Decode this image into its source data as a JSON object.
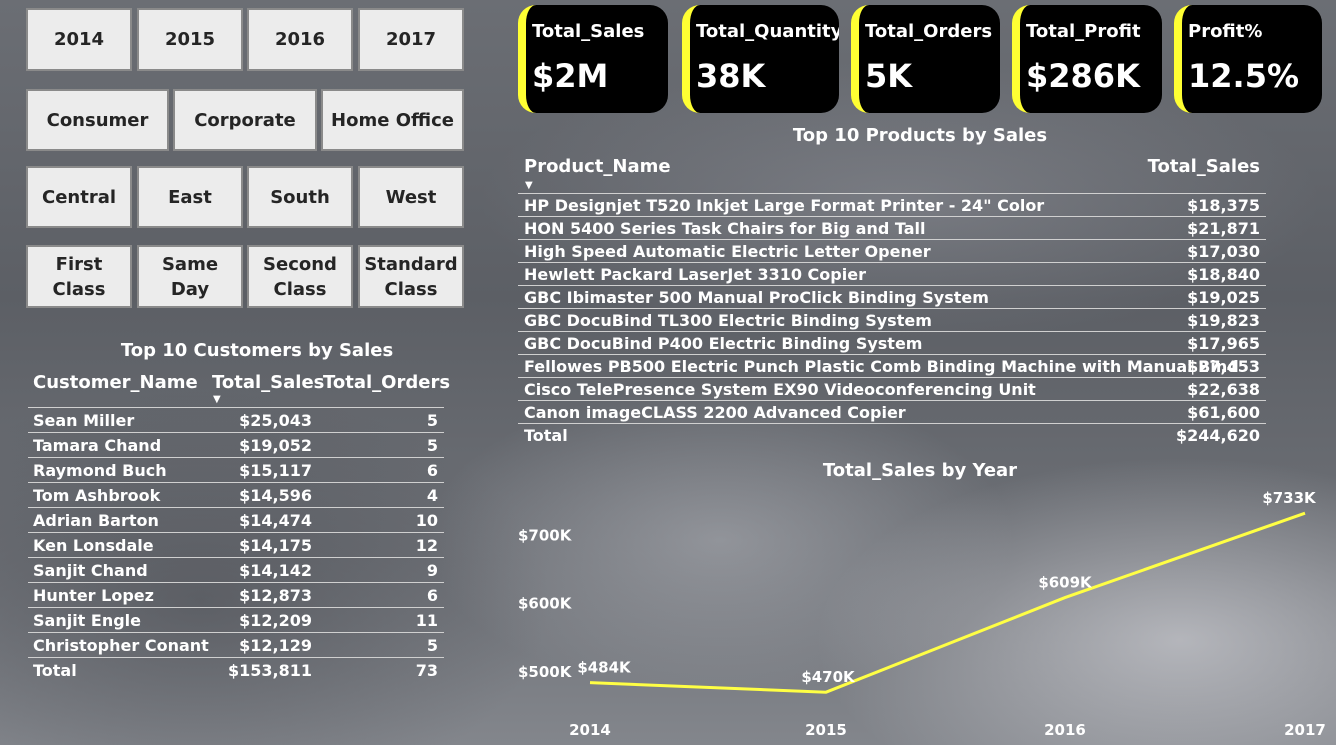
{
  "slicers": {
    "years": [
      "2014",
      "2015",
      "2016",
      "2017"
    ],
    "segments": [
      "Consumer",
      "Corporate",
      "Home Office"
    ],
    "regions": [
      "Central",
      "East",
      "South",
      "West"
    ],
    "ship_modes": [
      "First\nClass",
      "Same\nDay",
      "Second\nClass",
      "Standard\nClass"
    ]
  },
  "kpis": [
    {
      "label": "Total_Sales",
      "value": "$2M"
    },
    {
      "label": "Total_Quantity",
      "value": "38K"
    },
    {
      "label": "Total_Orders",
      "value": "5K"
    },
    {
      "label": "Total_Profit",
      "value": "$286K"
    },
    {
      "label": "Profit%",
      "value": "12.5%"
    }
  ],
  "customers": {
    "title": "Top 10 Customers by Sales",
    "columns": [
      "Customer_Name",
      "Total_Sales",
      "Total_Orders"
    ],
    "rows": [
      [
        "Sean Miller",
        "$25,043",
        "5"
      ],
      [
        "Tamara Chand",
        "$19,052",
        "5"
      ],
      [
        "Raymond Buch",
        "$15,117",
        "6"
      ],
      [
        "Tom Ashbrook",
        "$14,596",
        "4"
      ],
      [
        "Adrian Barton",
        "$14,474",
        "10"
      ],
      [
        "Ken Lonsdale",
        "$14,175",
        "12"
      ],
      [
        "Sanjit Chand",
        "$14,142",
        "9"
      ],
      [
        "Hunter Lopez",
        "$12,873",
        "6"
      ],
      [
        "Sanjit Engle",
        "$12,209",
        "11"
      ],
      [
        "Christopher Conant",
        "$12,129",
        "5"
      ]
    ],
    "total": [
      "Total",
      "$153,811",
      "73"
    ]
  },
  "products": {
    "title": "Top 10 Products by Sales",
    "columns": [
      "Product_Name",
      "Total_Sales"
    ],
    "rows": [
      [
        "HP Designjet T520 Inkjet Large Format Printer - 24\" Color",
        "$18,375"
      ],
      [
        "HON 5400 Series Task Chairs for Big and Tall",
        "$21,871"
      ],
      [
        "High Speed Automatic Electric Letter Opener",
        "$17,030"
      ],
      [
        "Hewlett Packard LaserJet 3310 Copier",
        "$18,840"
      ],
      [
        "GBC Ibimaster 500 Manual ProClick Binding System",
        "$19,025"
      ],
      [
        "GBC DocuBind TL300 Electric Binding System",
        "$19,823"
      ],
      [
        "GBC DocuBind P400 Electric Binding System",
        "$17,965"
      ],
      [
        "Fellowes PB500 Electric Punch Plastic Comb Binding Machine with Manual Bind",
        "$27,453"
      ],
      [
        "Cisco TelePresence System EX90 Videoconferencing Unit",
        "$22,638"
      ],
      [
        "Canon imageCLASS 2200 Advanced Copier",
        "$61,600"
      ]
    ],
    "total": [
      "Total",
      "$244,620"
    ]
  },
  "chart_data": {
    "type": "line",
    "title": "Total_Sales by Year",
    "x": [
      "2014",
      "2015",
      "2016",
      "2017"
    ],
    "series": [
      {
        "values": [
          484,
          470,
          609,
          733
        ]
      }
    ],
    "data_labels": [
      "$484K",
      "$470K",
      "$609K",
      "$733K"
    ],
    "y_ticks": [
      500,
      600,
      700
    ],
    "y_tick_labels": [
      "$500K",
      "$600K",
      "$700K"
    ],
    "ylim": [
      460,
      745
    ],
    "line_color": "#ffff44",
    "grid": false,
    "xlabel": "",
    "ylabel": ""
  },
  "colors": {
    "kpi_accent": "#ffff33",
    "kpi_bg": "#000000",
    "slicer_bg": "#ececec"
  }
}
